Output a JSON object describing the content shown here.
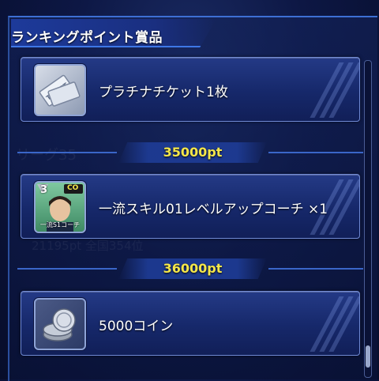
{
  "header": {
    "title": "ランキングポイント賞品"
  },
  "rewards": [
    {
      "label": "プラチナチケット1枚",
      "icon": "platinum-ticket-icon"
    },
    {
      "label": "一流スキル01レベルアップコーチ ×1",
      "icon": "coach-card-icon",
      "badge_level": "3",
      "badge_tag": "CO",
      "card_caption": "一流S1コーチ"
    },
    {
      "label": "5000コイン",
      "icon": "coin-stack-icon"
    }
  ],
  "thresholds": [
    {
      "points": "35000pt"
    },
    {
      "points": "36000pt"
    }
  ],
  "background_ghost": {
    "league": "リーグ35",
    "rank_info": "21195pt 全国354位"
  },
  "colors": {
    "accent_blue": "#3d6fd4",
    "points_yellow": "#f4e64a",
    "card_border": "#6f89d4"
  }
}
